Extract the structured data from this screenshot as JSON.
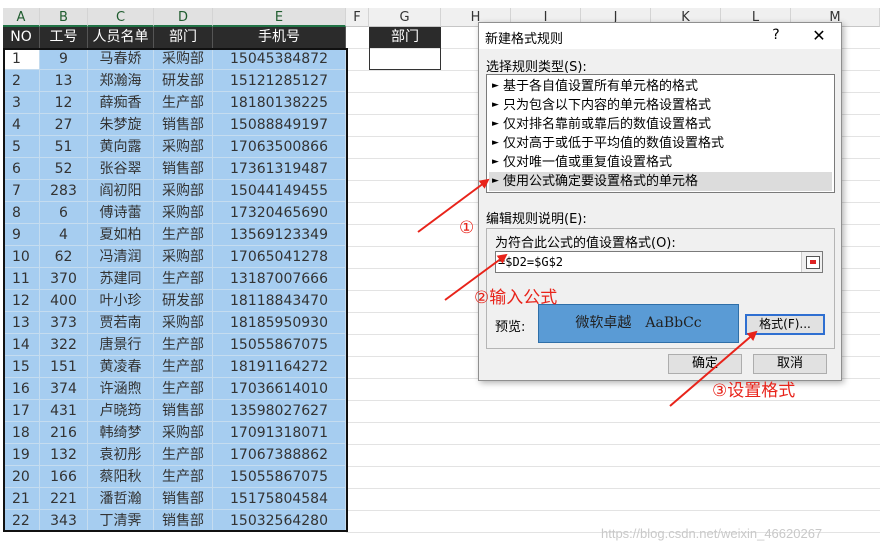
{
  "columns": [
    "A",
    "B",
    "C",
    "D",
    "E",
    "F",
    "G",
    "H",
    "I",
    "J",
    "K",
    "L",
    "M"
  ],
  "table": {
    "headers": [
      "NO",
      "工号",
      "人员名单",
      "部门",
      "手机号"
    ],
    "rows": [
      [
        "1",
        "9",
        "马春娇",
        "采购部",
        "15045384872"
      ],
      [
        "2",
        "13",
        "郑瀚海",
        "研发部",
        "15121285127"
      ],
      [
        "3",
        "12",
        "薛痴香",
        "生产部",
        "18180138225"
      ],
      [
        "4",
        "27",
        "朱梦旋",
        "销售部",
        "15088849197"
      ],
      [
        "5",
        "51",
        "黄向露",
        "采购部",
        "17063500866"
      ],
      [
        "6",
        "52",
        "张谷翠",
        "销售部",
        "17361319487"
      ],
      [
        "7",
        "283",
        "阎初阳",
        "采购部",
        "15044149455"
      ],
      [
        "8",
        "6",
        "傅诗蕾",
        "采购部",
        "17320465690"
      ],
      [
        "9",
        "4",
        "夏如柏",
        "生产部",
        "13569123349"
      ],
      [
        "10",
        "62",
        "冯清润",
        "采购部",
        "17065041278"
      ],
      [
        "11",
        "370",
        "苏建同",
        "生产部",
        "13187007666"
      ],
      [
        "12",
        "400",
        "叶小珍",
        "研发部",
        "18118843470"
      ],
      [
        "13",
        "373",
        "贾若南",
        "采购部",
        "18185950930"
      ],
      [
        "14",
        "322",
        "唐景行",
        "生产部",
        "15055867075"
      ],
      [
        "15",
        "151",
        "黄凌春",
        "生产部",
        "18191164272"
      ],
      [
        "16",
        "374",
        "许涵煦",
        "生产部",
        "17036614010"
      ],
      [
        "17",
        "431",
        "卢晓筠",
        "销售部",
        "13598027627"
      ],
      [
        "18",
        "216",
        "韩绮梦",
        "采购部",
        "17091318071"
      ],
      [
        "19",
        "132",
        "袁初彤",
        "生产部",
        "17067388862"
      ],
      [
        "20",
        "166",
        "蔡阳秋",
        "生产部",
        "15055867075"
      ],
      [
        "21",
        "221",
        "潘哲瀚",
        "销售部",
        "15175804584"
      ],
      [
        "22",
        "343",
        "丁清霁",
        "销售部",
        "15032564280"
      ]
    ]
  },
  "g_header": "部门",
  "dialog": {
    "title": "新建格式规则",
    "help": "?",
    "close": "✕",
    "rule_type_label": "选择规则类型(S):",
    "rule_types": [
      "基于各自值设置所有单元格的格式",
      "只为包含以下内容的单元格设置格式",
      "仅对排名靠前或靠后的数值设置格式",
      "仅对高于或低于平均值的数值设置格式",
      "仅对唯一值或重复值设置格式",
      "使用公式确定要设置格式的单元格"
    ],
    "rule_bullet": "►",
    "desc_label": "编辑规则说明(E):",
    "formula_label": "为符合此公式的值设置格式(O):",
    "formula_value": "=$D2=$G$2",
    "preview_label": "预览:",
    "preview_cn": "微软卓越",
    "preview_en": "AaBbCc",
    "format_button": "格式(F)...",
    "ok_button": "确定",
    "cancel_button": "取消"
  },
  "annotations": {
    "step1": "①",
    "step2": "②输入公式",
    "step3": "③设置格式",
    "color": "#e8231a"
  },
  "watermark": "https://blog.csdn.net/weixin_46620267",
  "colors": {
    "selection_fill": "#a6cdf0",
    "header_dark": "#2b2b2b",
    "preview_fill": "#5a9bd5"
  }
}
